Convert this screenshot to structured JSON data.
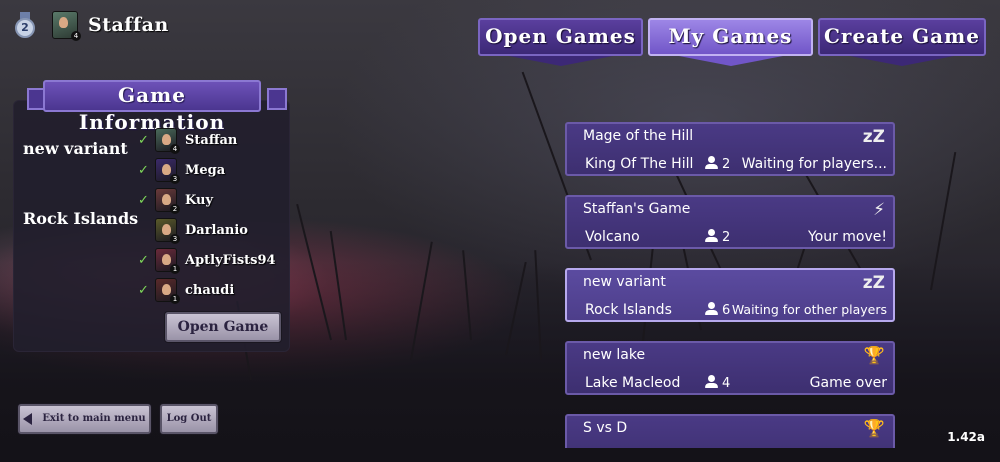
{
  "player": {
    "rank": "2",
    "level": "4",
    "name": "Staffan"
  },
  "tabs": [
    {
      "label": "Open Games",
      "active": false
    },
    {
      "label": "My Games",
      "active": true
    },
    {
      "label": "Create Game",
      "active": false
    }
  ],
  "info_panel": {
    "title": "Game Information",
    "variant": "new variant",
    "map": "Rock Islands",
    "players": [
      {
        "name": "Staffan",
        "checked": true,
        "level": "4",
        "avatar_color": "#4a6a5a"
      },
      {
        "name": "Mega",
        "checked": true,
        "level": "3",
        "avatar_color": "#3b2a6a"
      },
      {
        "name": "Kuy",
        "checked": true,
        "level": "2",
        "avatar_color": "#6a3a3a"
      },
      {
        "name": "Darlanio",
        "checked": false,
        "level": "3",
        "avatar_color": "#5a5a2a"
      },
      {
        "name": "AptlyFists94",
        "checked": true,
        "level": "1",
        "avatar_color": "#6a2a3a"
      },
      {
        "name": "chaudi",
        "checked": true,
        "level": "1",
        "avatar_color": "#5a2a2a"
      }
    ],
    "open_button": "Open Game"
  },
  "buttons": {
    "exit": "Exit to main menu",
    "logout": "Log Out"
  },
  "games": [
    {
      "name": "Mage of the Hill",
      "map": "King Of The Hill",
      "players": "2",
      "status": "Waiting for players...",
      "icon": "sleep-icon",
      "glyph": "zZ",
      "selected": false
    },
    {
      "name": "Staffan's Game",
      "map": "Volcano",
      "players": "2",
      "status": "Your move!",
      "icon": "lightning-icon",
      "glyph": "⚡",
      "selected": false
    },
    {
      "name": "new variant",
      "map": "Rock Islands",
      "players": "6",
      "status": "Waiting for other players",
      "icon": "sleep-icon",
      "glyph": "zZ",
      "selected": true
    },
    {
      "name": "new lake",
      "map": "Lake Macleod",
      "players": "4",
      "status": "Game over",
      "icon": "trophy-icon",
      "glyph": "🏆",
      "selected": false
    },
    {
      "name": "S vs D",
      "map": "",
      "players": "",
      "status": "",
      "icon": "trophy-icon",
      "glyph": "🏆",
      "selected": false
    }
  ],
  "version": "1.42a"
}
